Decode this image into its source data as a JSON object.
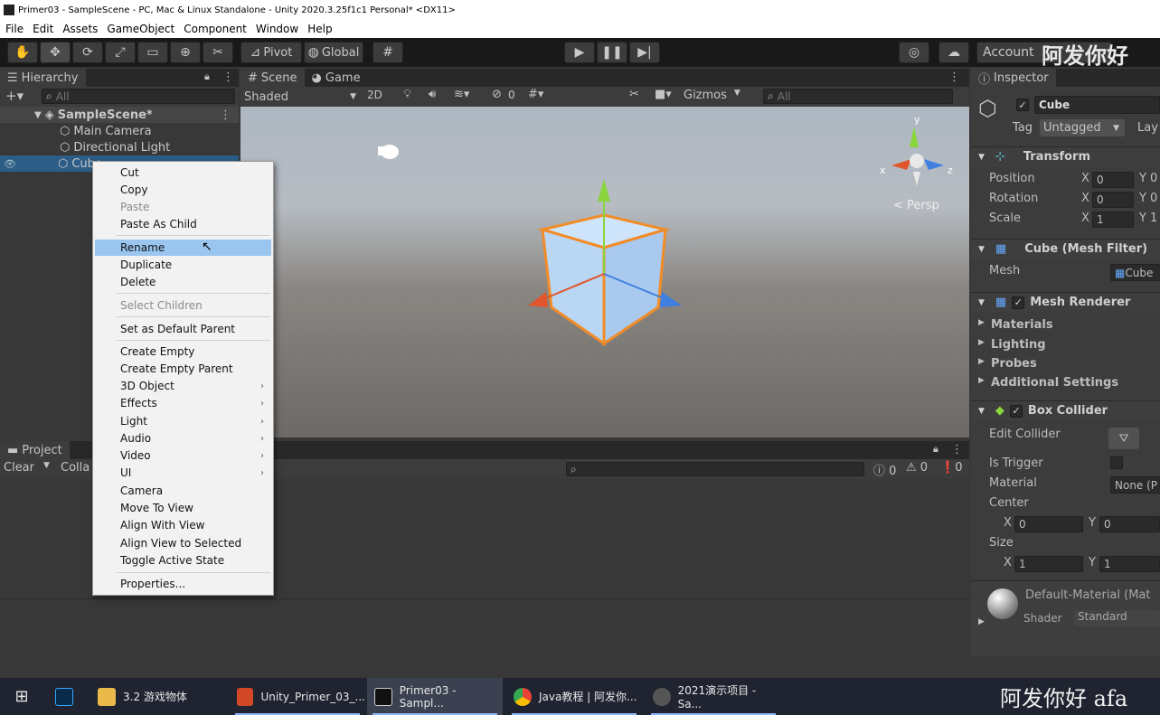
{
  "window": {
    "title": "Primer03 - SampleScene - PC, Mac & Linux Standalone - Unity 2020.3.25f1c1 Personal* <DX11>"
  },
  "menu": [
    "File",
    "Edit",
    "Assets",
    "GameObject",
    "Component",
    "Window",
    "Help"
  ],
  "toolbar": {
    "pivot": "Pivot",
    "global": "Global",
    "account": "Account"
  },
  "hierarchy": {
    "tab": "Hierarchy",
    "search_placeholder": "All",
    "scene": "SampleScene*",
    "items": [
      "Main Camera",
      "Directional Light",
      "Cube"
    ]
  },
  "scene": {
    "tabs": [
      "Scene",
      "Game"
    ],
    "draw_mode": "Shaded",
    "mode_2d": "2D",
    "hidden_count": "0",
    "gizmos": "Gizmos",
    "search_placeholder": "All",
    "persp": "< Persp",
    "axis_x": "x",
    "axis_y": "y",
    "axis_z": "z"
  },
  "project": {
    "tab": "Project",
    "clear": "Clear",
    "collapse": "Colla",
    "counts": [
      "0",
      "0",
      "0"
    ]
  },
  "inspector": {
    "tab": "Inspector",
    "object_name": "Cube",
    "tag_label": "Tag",
    "tag_value": "Untagged",
    "layer_label": "Lay",
    "transform": {
      "title": "Transform",
      "rows": [
        {
          "label": "Position",
          "x": "0",
          "y_label": "Y",
          "y": "0"
        },
        {
          "label": "Rotation",
          "x": "0",
          "y_label": "Y",
          "y": "0"
        },
        {
          "label": "Scale",
          "x": "1",
          "y_label": "Y",
          "y": "1"
        }
      ]
    },
    "mesh_filter": {
      "title": "Cube (Mesh Filter)",
      "mesh_label": "Mesh",
      "mesh_value": "Cube"
    },
    "mesh_renderer": {
      "title": "Mesh Renderer",
      "sections": [
        "Materials",
        "Lighting",
        "Probes",
        "Additional Settings"
      ]
    },
    "box_collider": {
      "title": "Box Collider",
      "edit": "Edit Collider",
      "trigger": "Is Trigger",
      "material": "Material",
      "material_value": "None (P",
      "center": "Center",
      "center_x": "0",
      "center_y": "0",
      "size": "Size",
      "size_x": "1",
      "size_y": "1"
    },
    "material": {
      "name": "Default-Material (Mat",
      "shader_label": "Shader",
      "shader_value": "Standard"
    }
  },
  "context_menu": [
    {
      "label": "Cut"
    },
    {
      "label": "Copy"
    },
    {
      "label": "Paste",
      "disabled": true
    },
    {
      "label": "Paste As Child"
    },
    {
      "label": "Rename",
      "highlight": true
    },
    {
      "label": "Duplicate"
    },
    {
      "label": "Delete"
    },
    {
      "label": "Select Children",
      "disabled": true
    },
    {
      "label": "Set as Default Parent"
    },
    {
      "label": "Create Empty"
    },
    {
      "label": "Create Empty Parent"
    },
    {
      "label": "3D Object",
      "sub": true
    },
    {
      "label": "Effects",
      "sub": true
    },
    {
      "label": "Light",
      "sub": true
    },
    {
      "label": "Audio",
      "sub": true
    },
    {
      "label": "Video",
      "sub": true
    },
    {
      "label": "UI",
      "sub": true
    },
    {
      "label": "Camera"
    },
    {
      "label": "Move To View"
    },
    {
      "label": "Align With View"
    },
    {
      "label": "Align View to Selected"
    },
    {
      "label": "Toggle Active State"
    },
    {
      "label": "Properties..."
    }
  ],
  "taskbar": [
    {
      "label": "3.2 游戏物体"
    },
    {
      "label": "Unity_Primer_03_..."
    },
    {
      "label": "Primer03 - Sampl..."
    },
    {
      "label": "Java教程 | 阿发你..."
    },
    {
      "label": "2021演示项目 - Sa..."
    }
  ],
  "watermark": {
    "top": "阿发你好",
    "bottom": "阿发你好 afa"
  },
  "colors": {
    "selection": "#2c5d87",
    "menu_highlight": "#99c5ee",
    "cube_outline": "#f28c28"
  }
}
